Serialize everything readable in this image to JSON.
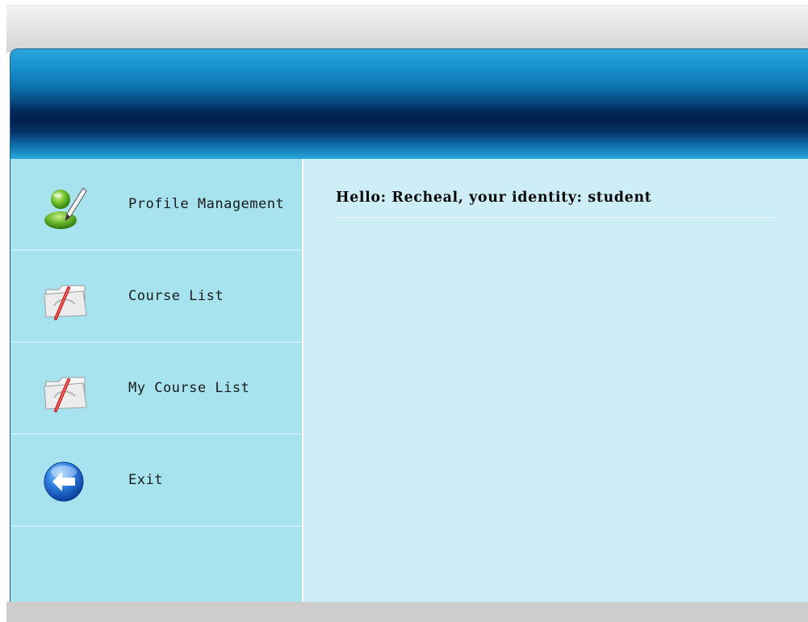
{
  "sidebar": {
    "items": [
      {
        "label": "Profile Management",
        "icon": "user-edit-icon"
      },
      {
        "label": "Course List",
        "icon": "folder-pen-icon"
      },
      {
        "label": "My Course List",
        "icon": "folder-pen-icon"
      },
      {
        "label": "Exit",
        "icon": "back-arrow-icon"
      }
    ]
  },
  "main": {
    "greeting": "Hello: Recheal, your identity: student"
  },
  "colors": {
    "banner_dark": "#021f4d",
    "banner_light": "#2aa6dc",
    "sidebar_bg": "#a6e3ef",
    "content_bg": "#cdeef6"
  }
}
